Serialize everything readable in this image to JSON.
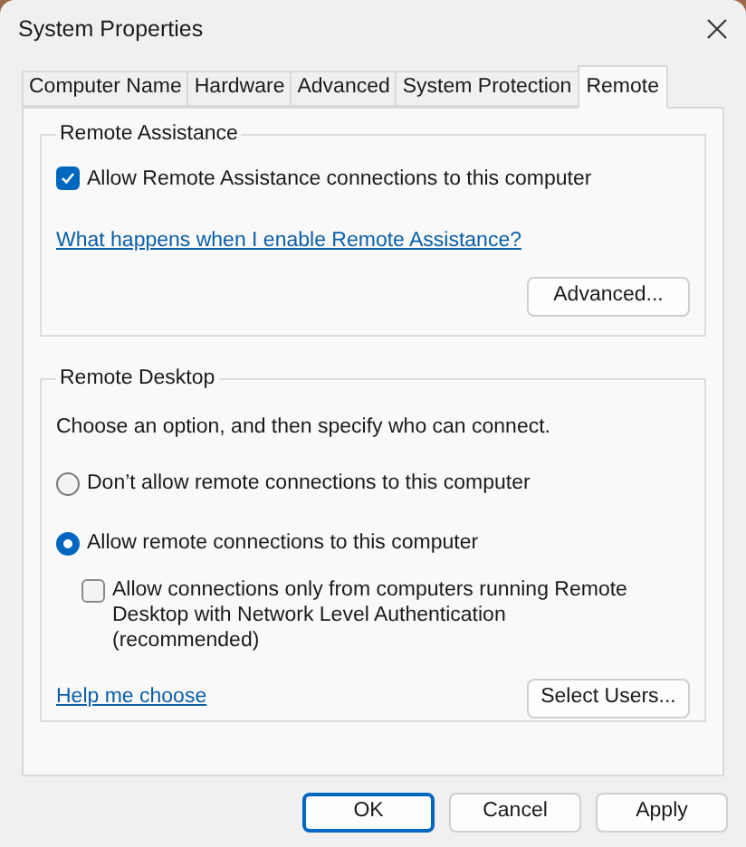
{
  "window": {
    "title": "System Properties"
  },
  "tabs": [
    {
      "label": "Computer Name",
      "selected": false
    },
    {
      "label": "Hardware",
      "selected": false
    },
    {
      "label": "Advanced",
      "selected": false
    },
    {
      "label": "System Protection",
      "selected": false
    },
    {
      "label": "Remote",
      "selected": true
    }
  ],
  "remote_assistance": {
    "title": "Remote Assistance",
    "allow": {
      "label": "Allow Remote Assistance connections to this computer",
      "checked": true
    },
    "link": "What happens when I enable Remote Assistance?",
    "button": "Advanced..."
  },
  "remote_desktop": {
    "title": "Remote Desktop",
    "instruction": "Choose an option, and then specify who can connect.",
    "options": [
      {
        "label": "Don’t allow remote connections to this computer",
        "selected": false
      },
      {
        "label": "Allow remote connections to this computer",
        "selected": true
      }
    ],
    "nla": {
      "label": "Allow connections only from computers running Remote Desktop with Network Level Authentication (recommended)",
      "checked": false
    },
    "link": "Help me choose",
    "button": "Select Users..."
  },
  "buttons": [
    "OK",
    "Cancel",
    "Apply"
  ]
}
